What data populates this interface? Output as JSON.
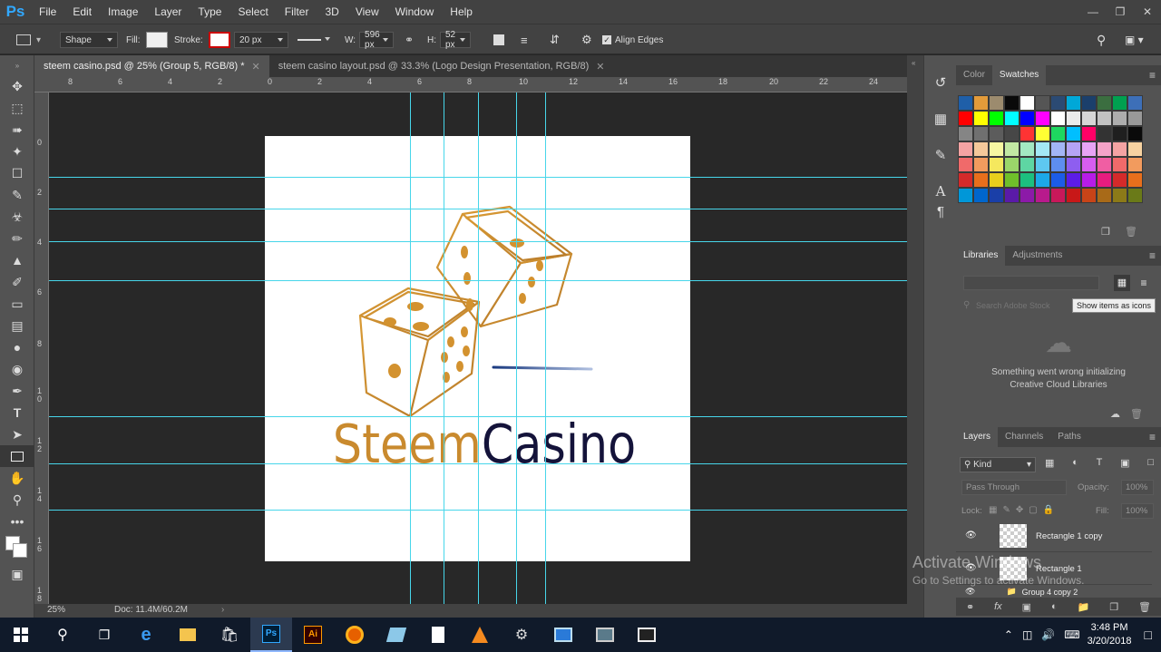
{
  "menubar": {
    "logo": "Ps",
    "items": [
      "File",
      "Edit",
      "Image",
      "Layer",
      "Type",
      "Select",
      "Filter",
      "3D",
      "View",
      "Window",
      "Help"
    ]
  },
  "options": {
    "mode": "Shape",
    "fill_label": "Fill:",
    "stroke_label": "Stroke:",
    "stroke_width": "20 px",
    "w_label": "W:",
    "w_value": "596 px",
    "h_label": "H:",
    "h_value": "52 px",
    "align_edges": "Align Edges"
  },
  "tabs": [
    {
      "label": "steem casino.psd @ 25% (Group 5, RGB/8) *"
    },
    {
      "label": "steem casino layout.psd @ 33.3% (Logo  Design  Presentation, RGB/8)"
    }
  ],
  "ruler_top": [
    "8",
    "6",
    "4",
    "2",
    "0",
    "2",
    "4",
    "6",
    "8",
    "10",
    "12",
    "14",
    "16",
    "18",
    "20",
    "22",
    "24"
  ],
  "ruler_left": [
    "0",
    "2",
    "4",
    "6",
    "8",
    "1\n0",
    "1\n2",
    "1\n4",
    "1\n6",
    "1\n8"
  ],
  "logo": {
    "word1": "Steem",
    "word2": "Casino",
    "gold": "#c98a2e",
    "navy": "#14133a"
  },
  "status": {
    "zoom": "25%",
    "doc": "Doc: 11.4M/60.2M"
  },
  "panels": {
    "color_tabs": [
      "Color",
      "Swatches"
    ],
    "libraries_tabs": [
      "Libraries",
      "Adjustments"
    ],
    "libraries_search_placeholder": "Search Adobe Stock",
    "tooltip": "Show items as icons",
    "libraries_error": "Something went wrong initializing Creative Cloud Libraries",
    "layers_tabs": [
      "Layers",
      "Channels",
      "Paths"
    ],
    "kind": "Kind",
    "blend": "Pass Through",
    "opacity_label": "Opacity:",
    "opacity": "100%",
    "lock_label": "Lock:",
    "fill_label": "Fill:",
    "fill": "100%",
    "layers": [
      {
        "name": "Rectangle 1 copy"
      },
      {
        "name": "Rectangle 1"
      },
      {
        "name": "Group 4 copy 2"
      }
    ]
  },
  "swatches": [
    "#1f5fa8",
    "#e39b3a",
    "#9c8b6e",
    "#0a0a0a",
    "#ffffff",
    "#555555",
    "#2b4a73",
    "#00a8d8",
    "#1b3f6b",
    "#3b6e40",
    "#00a050",
    "#3d6fb8",
    "#ff0000",
    "#ffff00",
    "#00ff00",
    "#00ffff",
    "#0000ff",
    "#ff00ff",
    "#ffffff",
    "#ebebeb",
    "#d6d6d6",
    "#c2c2c2",
    "#adadad",
    "#999999",
    "#858585",
    "#707070",
    "#5c5c5c",
    "#474747",
    "#ff3333",
    "#ffff33",
    "#1ed760",
    "#00bfff",
    "#ff0066",
    "#333333",
    "#1f1f1f",
    "#0a0a0a",
    "#f5a3a3",
    "#f5c89a",
    "#f7f7a1",
    "#c2e8a3",
    "#a3e8c2",
    "#a3e8f5",
    "#a3b5f5",
    "#b5a3f5",
    "#e8a3f5",
    "#f5a3c8",
    "#f5a3a3",
    "#f7d2a1",
    "#f06a6a",
    "#f29b5e",
    "#f5e85e",
    "#9bd66a",
    "#5ed6a3",
    "#5ec8f0",
    "#5e8ef0",
    "#8e5ef0",
    "#d65ef0",
    "#f05ea3",
    "#f06a6a",
    "#f29b5e",
    "#d42a2a",
    "#e86f1c",
    "#e8cf1c",
    "#6fbf2a",
    "#1cbf7f",
    "#1ca8e8",
    "#1c5ce8",
    "#5c1ce8",
    "#b71ce8",
    "#e81c7f",
    "#d42a2a",
    "#e86f1c",
    "#0097d8",
    "#0066cc",
    "#1a3fa8",
    "#5a1aa8",
    "#8c1aa8",
    "#b81a8c",
    "#c8185a",
    "#c81818",
    "#c84418",
    "#a86a18",
    "#8c7a18",
    "#6a7a18"
  ],
  "taskbar": {
    "time": "3:48 PM",
    "date": "3/20/2018"
  },
  "watermark": {
    "line1": "Activate Windows",
    "line2": "Go to Settings to activate Windows."
  }
}
